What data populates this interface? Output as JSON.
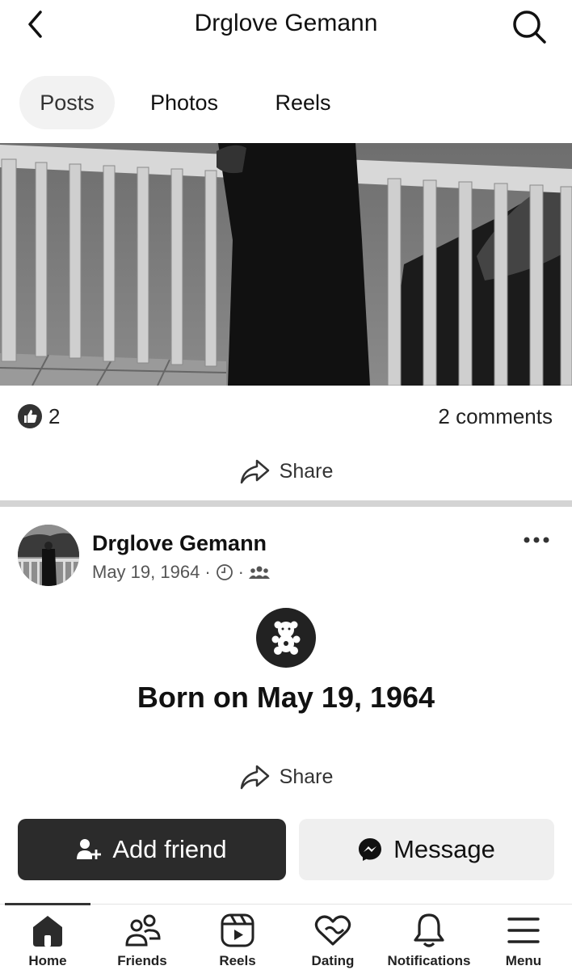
{
  "header": {
    "title": "Drglove Gemann"
  },
  "tabs": [
    {
      "label": "Posts",
      "active": true
    },
    {
      "label": "Photos",
      "active": false
    },
    {
      "label": "Reels",
      "active": false
    }
  ],
  "post1": {
    "like_count": "2",
    "comments": "2 comments",
    "share_label": "Share"
  },
  "post2": {
    "author": "Drglove Gemann",
    "date": "May 19, 1964",
    "life_event": "Born on May 19, 1964",
    "share_label": "Share"
  },
  "actions": {
    "add_friend": "Add friend",
    "message": "Message"
  },
  "nav": [
    {
      "label": "Home",
      "icon": "home-icon",
      "active": true
    },
    {
      "label": "Friends",
      "icon": "friends-icon"
    },
    {
      "label": "Reels",
      "icon": "reels-icon"
    },
    {
      "label": "Dating",
      "icon": "dating-icon"
    },
    {
      "label": "Notifications",
      "icon": "bell-icon"
    },
    {
      "label": "Menu",
      "icon": "menu-icon"
    }
  ],
  "colors": {
    "dark_button": "#2b2b2b",
    "light_button": "#efefef",
    "divider": "#d4d4d4"
  }
}
